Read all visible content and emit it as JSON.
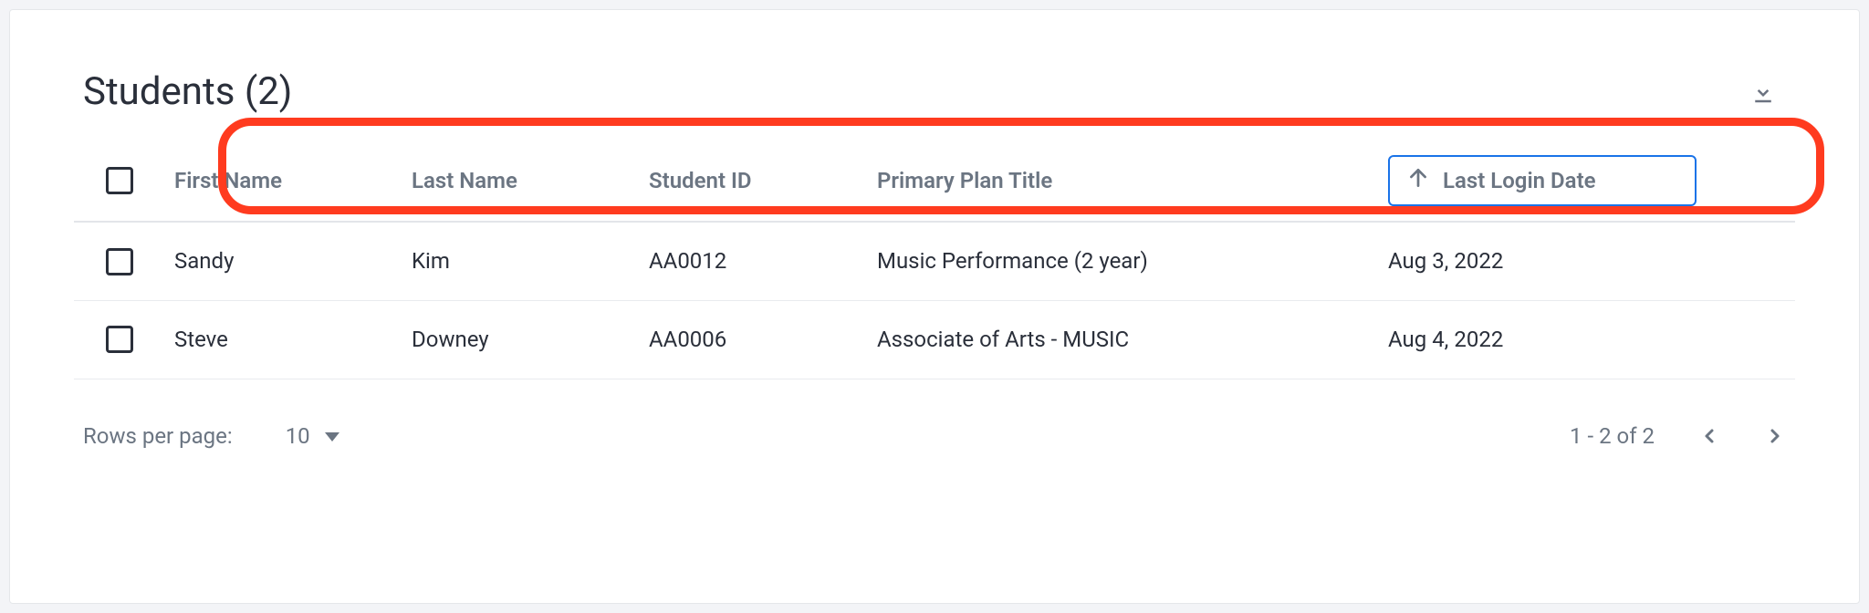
{
  "header": {
    "title": "Students (2)"
  },
  "table": {
    "columns": {
      "first_name": "First Name",
      "last_name": "Last Name",
      "student_id": "Student ID",
      "primary_plan_title": "Primary Plan Title",
      "last_login_date": "Last Login Date"
    },
    "sort": {
      "column": "last_login_date",
      "direction": "asc"
    },
    "rows": [
      {
        "first_name": "Sandy",
        "last_name": "Kim",
        "student_id": "AA0012",
        "primary_plan_title": "Music Performance (2 year)",
        "last_login_date": "Aug 3, 2022"
      },
      {
        "first_name": "Steve",
        "last_name": "Downey",
        "student_id": "AA0006",
        "primary_plan_title": "Associate of Arts - MUSIC",
        "last_login_date": "Aug 4, 2022"
      }
    ]
  },
  "pagination": {
    "rows_per_page_label": "Rows per page:",
    "rows_per_page_value": "10",
    "range_text": "1 - 2 of 2"
  },
  "annotation": {
    "highlight": "column-headers"
  }
}
